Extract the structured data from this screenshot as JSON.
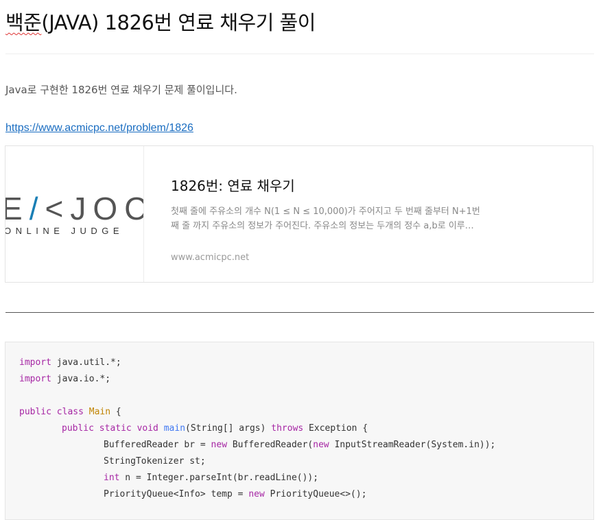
{
  "post": {
    "title": "백준(JAVA) 1826번 연료 채우기 풀이",
    "title_spellcheck": "백준",
    "title_rest": "(JAVA) 1826번 연료 채우기 풀이",
    "intro": "Java로 구현한 1826번 연료 채우기 문제 풀이입니다.",
    "link_text": "https://www.acmicpc.net/problem/1826"
  },
  "link_card": {
    "logo_left": "E",
    "logo_slash": "/",
    "logo_right": "<JOC",
    "logo_sub": "ONLINE JUDGE",
    "title": "1826번: 연료 채우기",
    "description_line1": "첫째 줄에 주유소의 개수 N(1 ≤ N ≤ 10,000)가 주어지고 두 번째 줄부터 N+1번",
    "description_line2": "째 줄 까지 주유소의 정보가 주어진다. 주유소의 정보는 두개의 정수 a,b로 이루…",
    "domain": "www.acmicpc.net"
  },
  "code": {
    "l1_kw": "import",
    "l1_rest": " java.util.*;",
    "l2_kw": "import",
    "l2_rest": " java.io.*;",
    "l4_kw": "public class",
    "l4_cls": "Main",
    "l4_rest": " {",
    "l5_kw": "public static void",
    "l5_fn": "main",
    "l5_mid": "(String[] args) ",
    "l5_kw2": "throws",
    "l5_rest": " Exception {",
    "l6_a": "BufferedReader br = ",
    "l6_kw": "new",
    "l6_b": " BufferedReader(",
    "l6_kw2": "new",
    "l6_c": " InputStreamReader(System.in));",
    "l7": "StringTokenizer st;",
    "l8_kw": "int",
    "l8_rest": " n = Integer.parseInt(br.readLine());",
    "l9_a": "PriorityQueue<Info> temp = ",
    "l9_kw": "new",
    "l9_b": " PriorityQueue<>();"
  }
}
